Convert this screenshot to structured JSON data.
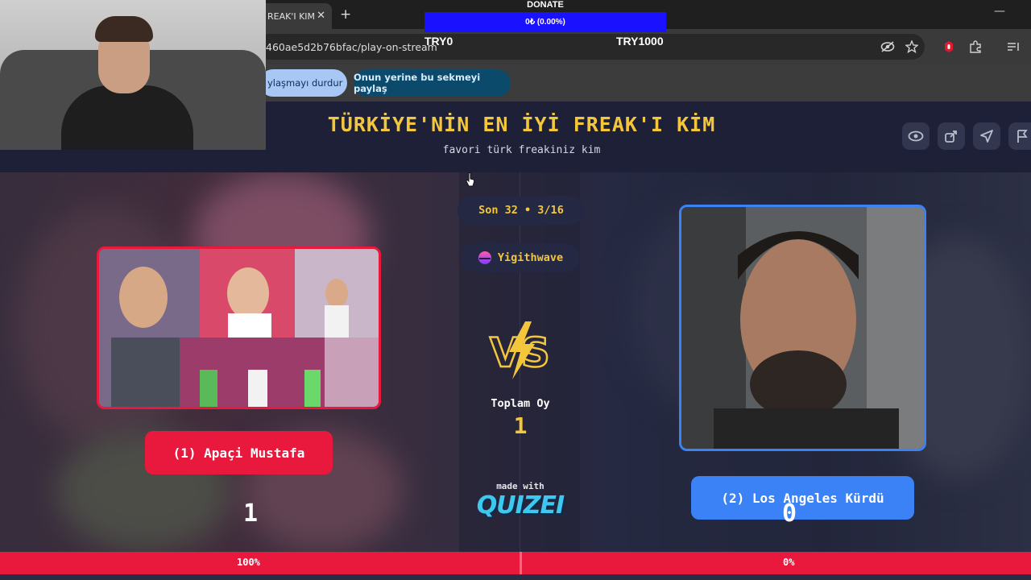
{
  "browser": {
    "tab_title": "REAK'I KIM",
    "tab_close": "✕",
    "new_tab": "+",
    "minimize": "—",
    "url": "460ae5d2b76bfac/play-on-stream"
  },
  "screen_share": {
    "stop_label": "ylaşmayı durdur",
    "share_this_tab_label": "Onun yerine bu sekmeyi paylaş"
  },
  "donation": {
    "title": "DONATE",
    "progress_text": "0₺ (0.00%)",
    "progress": 0,
    "min_label": "TRY0",
    "max_label": "TRY1000"
  },
  "quiz": {
    "title": "TÜRKİYE'NİN EN İYİ FREAK'I KİM",
    "subtitle": "favori türk freakiniz kim",
    "round": "Son 32 • 3/16",
    "player": "Yigithwave",
    "total_votes_label": "Toplam Oy",
    "total_votes": "1",
    "made_with": "made with",
    "brand": "QUIZEI",
    "left_choice": {
      "label": "(1) Apaçi Mustafa",
      "votes": "1",
      "percent": "100%"
    },
    "right_choice": {
      "label": "(2) Los Angeles Kürdü",
      "votes": "0",
      "percent": "0%"
    }
  },
  "colors": {
    "accent_yellow": "#f3c63b",
    "left_red": "#e8193d",
    "right_blue": "#3b82f6",
    "donate_blue": "#1a12ff"
  }
}
